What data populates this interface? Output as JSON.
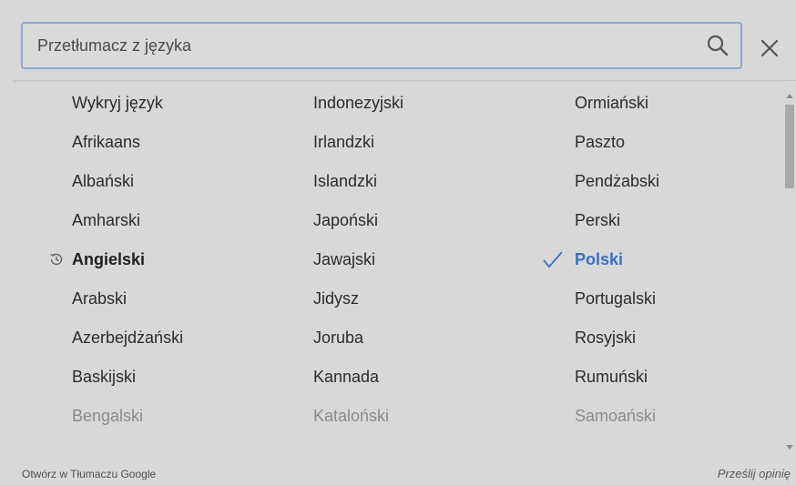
{
  "search": {
    "placeholder": "Przetłumacz z języka"
  },
  "icons": {
    "search": "search-icon",
    "close": "close-icon",
    "history": "history-icon",
    "check": "check-icon"
  },
  "colors": {
    "selected": "#3a6fc4",
    "search_border": "#8fa8cc"
  },
  "columns": [
    {
      "items": [
        {
          "label": "Wykryj język",
          "state": "normal"
        },
        {
          "label": "Afrikaans",
          "state": "normal"
        },
        {
          "label": "Albański",
          "state": "normal"
        },
        {
          "label": "Amharski",
          "state": "normal"
        },
        {
          "label": "Angielski",
          "state": "recent"
        },
        {
          "label": "Arabski",
          "state": "normal"
        },
        {
          "label": "Azerbejdżański",
          "state": "normal"
        },
        {
          "label": "Baskijski",
          "state": "normal"
        },
        {
          "label": "Bengalski",
          "state": "faded"
        }
      ]
    },
    {
      "items": [
        {
          "label": "Indonezyjski",
          "state": "normal"
        },
        {
          "label": "Irlandzki",
          "state": "normal"
        },
        {
          "label": "Islandzki",
          "state": "normal"
        },
        {
          "label": "Japoński",
          "state": "normal"
        },
        {
          "label": "Jawajski",
          "state": "normal"
        },
        {
          "label": "Jidysz",
          "state": "normal"
        },
        {
          "label": "Joruba",
          "state": "normal"
        },
        {
          "label": "Kannada",
          "state": "normal"
        },
        {
          "label": "Kataloński",
          "state": "faded"
        }
      ]
    },
    {
      "items": [
        {
          "label": "Ormiański",
          "state": "normal"
        },
        {
          "label": "Paszto",
          "state": "normal"
        },
        {
          "label": "Pendżabski",
          "state": "normal"
        },
        {
          "label": "Perski",
          "state": "normal"
        },
        {
          "label": "Polski",
          "state": "selected"
        },
        {
          "label": "Portugalski",
          "state": "normal"
        },
        {
          "label": "Rosyjski",
          "state": "normal"
        },
        {
          "label": "Rumuński",
          "state": "normal"
        },
        {
          "label": "Samoański",
          "state": "faded"
        }
      ]
    }
  ],
  "footer": {
    "open_link": "Otwórz w Tłumaczu Google",
    "feedback_link": "Prześlij opinię"
  }
}
